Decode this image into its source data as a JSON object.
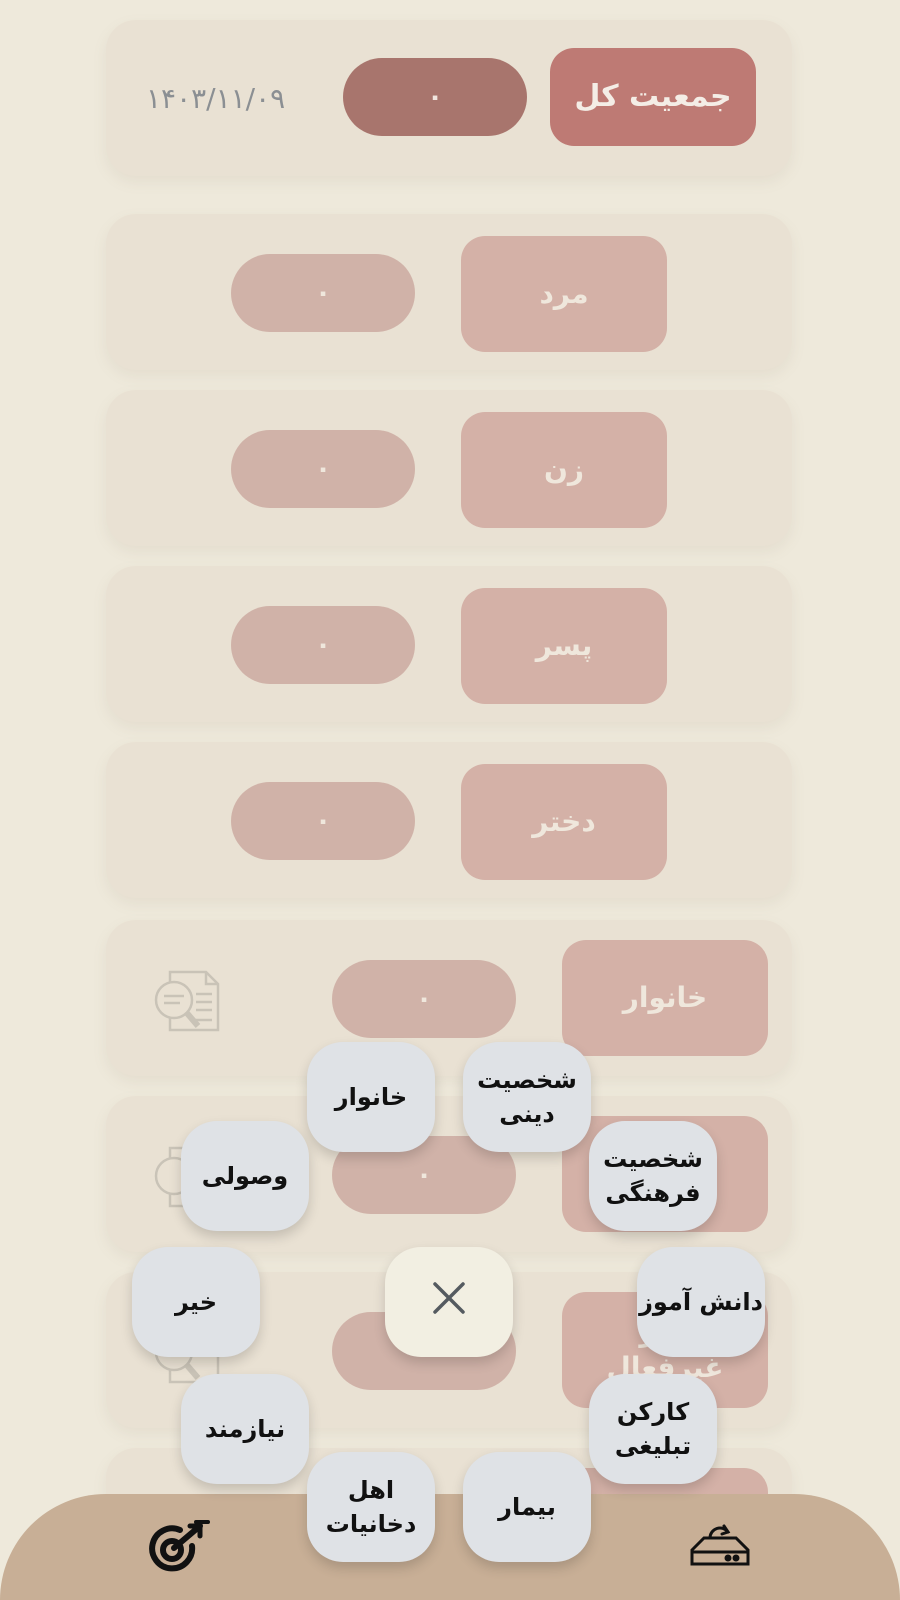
{
  "header": {
    "title": "جمعیت کل",
    "count": "۰",
    "date": "۱۴۰۳/۱۱/۰۹"
  },
  "rows": [
    {
      "label": "مرد",
      "count": "۰"
    },
    {
      "label": "زن",
      "count": "۰"
    },
    {
      "label": "پسر",
      "count": "۰"
    },
    {
      "label": "دختر",
      "count": "۰"
    }
  ],
  "detail_rows": [
    {
      "label": "خانوار",
      "count": "۰"
    },
    {
      "label": "د",
      "count": "۰"
    },
    {
      "label": "موز\nغیرفعال",
      "count": ""
    }
  ],
  "fab_menu": {
    "family": "خانوار",
    "religious": "شخصیت\nدینی",
    "collection": "وصولی",
    "cultural": "شخصیت\nفرهنگی",
    "charity": "خیر",
    "student": "دانش آموز",
    "needy": "نیازمند",
    "promo_worker": "کارکن\nتبلیغی",
    "smokers": "اهل\nدخانیات",
    "sick": "بیمار"
  },
  "icons": {
    "close": "close-icon",
    "doc_search": "document-search-icon",
    "target": "target-icon",
    "sync": "cloud-sync-icon"
  },
  "colors": {
    "background": "#EEE9DB",
    "card": "#E9E1D3",
    "accent": "#BE7A74",
    "accent_dark": "#A8756D",
    "bottom_bar": "#C8AF96",
    "fab": "#DFE2E6"
  }
}
